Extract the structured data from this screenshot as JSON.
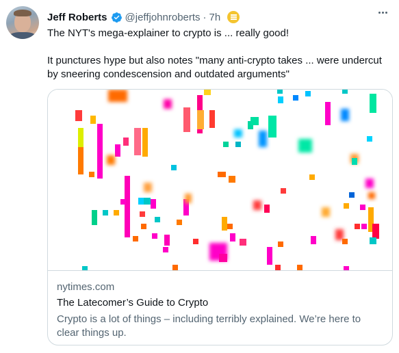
{
  "tweet": {
    "author_name": "Jeff Roberts",
    "handle": "@jeffjohnroberts",
    "separator": "·",
    "time": "7h",
    "text_line1": "The NYT's mega-explainer to crypto is ... really good!",
    "text_line2": "It punctures hype but also notes \"many anti-crypto takes ... were undercut by sneering condescension and outdated arguments\""
  },
  "icons": {
    "verified": "verified-badge-icon",
    "chip": "list-chip-icon",
    "more": "more-options-icon"
  },
  "link_card": {
    "domain": "nytimes.com",
    "title": "The Latecomer’s Guide to Crypto",
    "description": "Crypto is a lot of things – including terribly explained. We’re here to clear things up."
  },
  "colors": {
    "verified": "#1d9bf0",
    "chip": "#f4c430",
    "secondary_text": "#536471",
    "border": "#cfd9de"
  }
}
